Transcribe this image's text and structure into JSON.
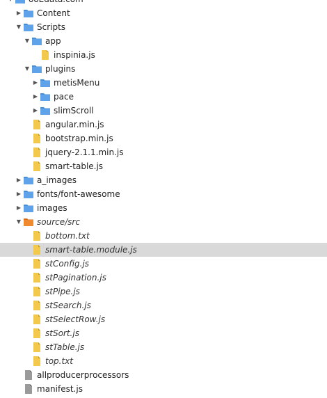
{
  "tree": {
    "items": [
      {
        "label": "ooEdata.com",
        "type": "root",
        "depth": 0,
        "expanded": true
      },
      {
        "label": "Content",
        "type": "folder",
        "depth": 1,
        "expanded": false
      },
      {
        "label": "Scripts",
        "type": "folder",
        "depth": 1,
        "expanded": true
      },
      {
        "label": "app",
        "type": "folder",
        "depth": 2,
        "expanded": true
      },
      {
        "label": "inspinia.js",
        "type": "file",
        "depth": 3
      },
      {
        "label": "plugins",
        "type": "folder",
        "depth": 2,
        "expanded": true
      },
      {
        "label": "metisMenu",
        "type": "folder",
        "depth": 3,
        "expanded": false
      },
      {
        "label": "pace",
        "type": "folder",
        "depth": 3,
        "expanded": false
      },
      {
        "label": "slimScroll",
        "type": "folder",
        "depth": 3,
        "expanded": false
      },
      {
        "label": "angular.min.js",
        "type": "file",
        "depth": 2
      },
      {
        "label": "bootstrap.min.js",
        "type": "file",
        "depth": 2
      },
      {
        "label": "jquery-2.1.1.min.js",
        "type": "file",
        "depth": 2
      },
      {
        "label": "smart-table.js",
        "type": "file",
        "depth": 2
      },
      {
        "label": "a_images",
        "type": "folder",
        "depth": 1,
        "expanded": false
      },
      {
        "label": "fonts/font-awesome",
        "type": "folder",
        "depth": 1,
        "expanded": false
      },
      {
        "label": "images",
        "type": "folder",
        "depth": 1,
        "expanded": false
      },
      {
        "label": "source/src",
        "type": "folder-orange",
        "depth": 1,
        "expanded": true,
        "italic": true
      },
      {
        "label": "bottom.txt",
        "type": "file",
        "depth": 2,
        "italic": true
      },
      {
        "label": "smart-table.module.js",
        "type": "file",
        "depth": 2,
        "italic": true,
        "selected": true
      },
      {
        "label": "stConfig.js",
        "type": "file",
        "depth": 2,
        "italic": true
      },
      {
        "label": "stPagination.js",
        "type": "file",
        "depth": 2,
        "italic": true
      },
      {
        "label": "stPipe.js",
        "type": "file",
        "depth": 2,
        "italic": true
      },
      {
        "label": "stSearch.js",
        "type": "file",
        "depth": 2,
        "italic": true
      },
      {
        "label": "stSelectRow.js",
        "type": "file",
        "depth": 2,
        "italic": true
      },
      {
        "label": "stSort.js",
        "type": "file",
        "depth": 2,
        "italic": true
      },
      {
        "label": "stTable.js",
        "type": "file",
        "depth": 2,
        "italic": true
      },
      {
        "label": "top.txt",
        "type": "file",
        "depth": 2,
        "italic": true
      },
      {
        "label": "allproducerprocessors",
        "type": "file-gray",
        "depth": 1
      },
      {
        "label": "manifest.js",
        "type": "file-gray",
        "depth": 1
      }
    ]
  },
  "colors": {
    "folder": "#5ea2ea",
    "folder_special": "#f08a2e",
    "file": "#f2c94c",
    "file_other": "#9a9a9a",
    "selection": "#d9d9d9"
  },
  "icons": {
    "expanded": "triangle-down",
    "collapsed": "triangle-right"
  }
}
